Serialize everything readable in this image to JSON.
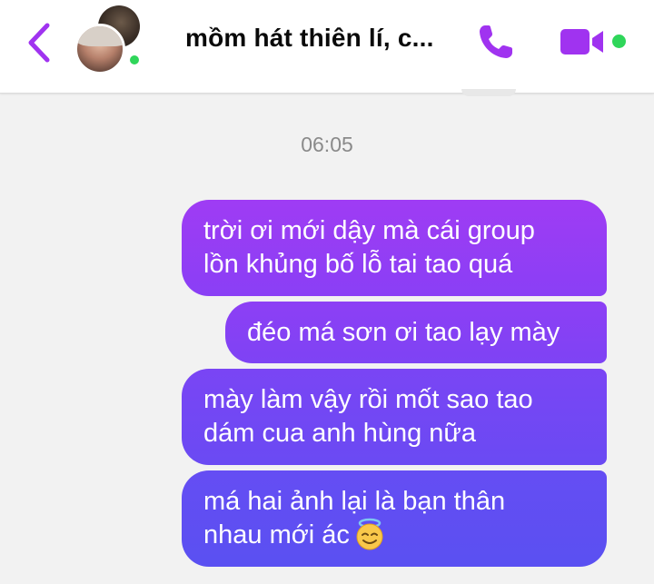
{
  "header": {
    "title": "mồm hát thiên lí, c...",
    "back_icon": "chevron-left-icon",
    "call_icon": "phone-icon",
    "video_icon": "video-camera-icon",
    "accent_color": "#a033f0",
    "online_color": "#2fd65a"
  },
  "conversation": {
    "timestamp": "06:05",
    "messages": [
      {
        "lines": [
          "trời ơi mới dậy mà cái group",
          "lồn khủng bố lỗ tai tao quá"
        ]
      },
      {
        "lines": [
          "đéo má sơn ơi tao lạy mày"
        ]
      },
      {
        "lines": [
          "mày làm vậy rồi mốt sao tao",
          "dám cua anh hùng nữa"
        ]
      },
      {
        "lines": [
          "má hai ảnh lại là bạn thân",
          "nhau mới ác"
        ],
        "emoji": "smiling-face-with-halo-emoji"
      }
    ]
  }
}
